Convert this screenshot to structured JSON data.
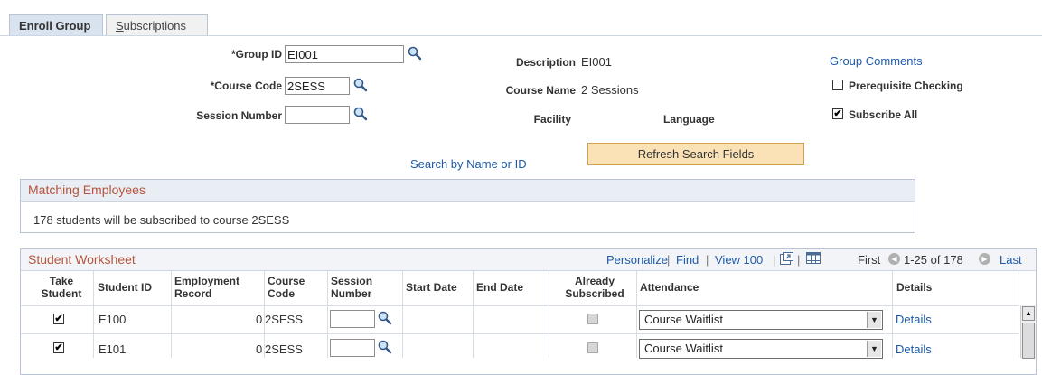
{
  "tabs": [
    {
      "label": "Enroll Group",
      "active": true
    },
    {
      "label": "Subscriptions",
      "access_key": "S",
      "rest": "ubscriptions",
      "active": false
    }
  ],
  "form": {
    "group_id_label": "*Group ID",
    "group_id_value": "EI001",
    "course_code_label": "*Course Code",
    "course_code_value": "2SESS",
    "session_number_label": "Session Number",
    "session_number_value": "",
    "description_label": "Description",
    "description_value": "EI001",
    "course_name_label": "Course Name",
    "course_name_value": "2 Sessions",
    "facility_label": "Facility",
    "language_label": "Language",
    "group_comments_link": "Group Comments",
    "prereq_label": "Prerequisite Checking",
    "prereq_checked": false,
    "subscribe_all_label": "Subscribe All",
    "subscribe_all_checked": true,
    "search_link": "Search by Name or ID",
    "refresh_button": "Refresh Search Fields"
  },
  "matching": {
    "title": "Matching Employees",
    "message": "178 students will be subscribed to course 2SESS"
  },
  "worksheet": {
    "title": "Student Worksheet",
    "personalize": "Personalize",
    "find": "Find",
    "view": "View 100",
    "sep": "|",
    "first": "First",
    "range": "1-25 of 178",
    "last": "Last",
    "columns": {
      "take_1": "Take",
      "take_2": "Student",
      "student_id": "Student ID",
      "emp_1": "Employment",
      "emp_2": "Record",
      "course_1": "Course",
      "course_2": "Code",
      "session_1": "Session",
      "session_2": "Number",
      "start_date": "Start Date",
      "end_date": "End Date",
      "already_1": "Already",
      "already_2": "Subscribed",
      "attendance": "Attendance",
      "details": "Details"
    },
    "rows": [
      {
        "take": "✔",
        "student_id": "E100",
        "emp_record": "0",
        "course_code": "2SESS",
        "attendance": "Course Waitlist",
        "details": "Details"
      },
      {
        "take": "✔",
        "student_id": "E101",
        "emp_record": "0",
        "course_code": "2SESS",
        "attendance": "Course Waitlist",
        "details": "Details"
      }
    ]
  }
}
